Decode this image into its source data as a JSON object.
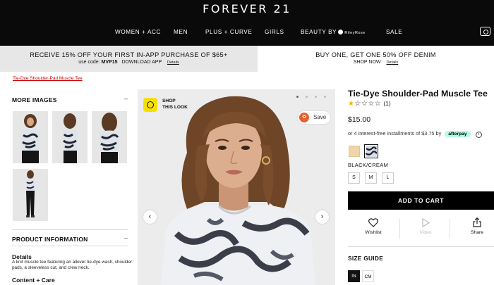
{
  "header": {
    "logo": "FOREVER 21",
    "nav": [
      "WOMEN + ACC",
      "MEN",
      "PLUS + CURVE",
      "GIRLS",
      "BEAUTY BY"
    ],
    "riley_rose": "RileyRose",
    "sale": "SALE"
  },
  "promo": {
    "left_main": "RECEIVE 15% OFF YOUR FIRST IN-APP PURCHASE OF $65+",
    "left_sub_prefix": "use code:",
    "left_code": "MVP15",
    "left_cta": "DOWNLOAD APP",
    "details": "Details",
    "right_main": "BUY ONE, GET ONE 50% OFF DENIM",
    "right_cta": "SHOP NOW"
  },
  "breadcrumb": "Tie-Dye Shoulder-Pad Muscle Tee",
  "left_col": {
    "more_images": "MORE IMAGES",
    "product_information": "PRODUCT INFORMATION",
    "details_heading": "Details",
    "details_text": "A knit muscle tee featuring an allover tie-dye wash, shoulder pads, a sleeveless cut, and crew neck.",
    "content_care": "Content + Care",
    "toggle": "–"
  },
  "main_image": {
    "shop_this_look": [
      "SHOP",
      "THIS LOOK"
    ],
    "save": "Save",
    "prev": "‹",
    "next": "›"
  },
  "product": {
    "title": "Tie-Dye Shoulder-Pad Muscle Tee",
    "rating_filled": "★",
    "rating_empty": "☆☆☆☆",
    "rating_count": "(1)",
    "price": "$15.00",
    "installments": "or 4 interest-free installments of $3.75 by",
    "afterpay": "afterpay",
    "info": "i",
    "color_name": "BLACK/CREAM",
    "sizes": [
      "S",
      "M",
      "L"
    ],
    "add_to_cart": "ADD TO CART",
    "wishlist": "Wishlist",
    "video": "Video",
    "share": "Share",
    "size_guide": "SIZE GUIDE",
    "units": [
      "IN",
      "CM"
    ]
  },
  "colors": {
    "swatch_tan": "#efd6a8",
    "afterpay_bg": "#b2fce4",
    "breadcrumb": "#cc0000",
    "shop_look_icon": "#f6e000"
  }
}
